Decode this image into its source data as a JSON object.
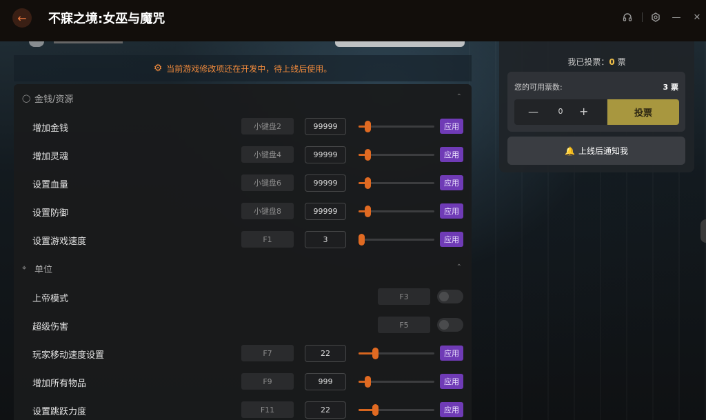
{
  "window": {
    "title": "不寐之境:女巫与魔咒"
  },
  "notice": "当前游戏修改项还在开发中，待上线后使用。",
  "sections": [
    {
      "title": "金钱/资源",
      "rows": [
        {
          "label": "增加金钱",
          "hotkey": "小键盘2",
          "value": "99999",
          "slider": 0.1,
          "apply": "应用"
        },
        {
          "label": "增加灵魂",
          "hotkey": "小键盘4",
          "value": "99999",
          "slider": 0.1,
          "apply": "应用"
        },
        {
          "label": "设置血量",
          "hotkey": "小键盘6",
          "value": "99999",
          "slider": 0.1,
          "apply": "应用"
        },
        {
          "label": "设置防御",
          "hotkey": "小键盘8",
          "value": "99999",
          "slider": 0.1,
          "apply": "应用"
        },
        {
          "label": "设置游戏速度",
          "hotkey": "F1",
          "value": "3",
          "slider": 0.0,
          "apply": "应用"
        }
      ]
    },
    {
      "title": "单位",
      "toggles": [
        {
          "label": "上帝模式",
          "hotkey": "F3",
          "on": false
        },
        {
          "label": "超级伤害",
          "hotkey": "F5",
          "on": false
        }
      ],
      "rows": [
        {
          "label": "玩家移动速度设置",
          "hotkey": "F7",
          "value": "22",
          "slider": 0.2,
          "apply": "应用"
        },
        {
          "label": "增加所有物品",
          "hotkey": "F9",
          "value": "999",
          "slider": 0.1,
          "apply": "应用"
        },
        {
          "label": "设置跳跃力度",
          "hotkey": "F11",
          "value": "22",
          "slider": 0.2,
          "apply": "应用"
        }
      ]
    }
  ],
  "vote": {
    "my_votes_prefix": "我已投票：",
    "my_votes": "0",
    "my_votes_unit": " 票",
    "available_label": "您的可用票数:",
    "available_count": "3 票",
    "stepper_value": "0",
    "vote_button": "投票",
    "notify_button": "上线后通知我"
  },
  "colors": {
    "accent_orange": "#e06a22",
    "apply_purple": "#6f3bb6",
    "vote_gold": "#a8973f",
    "votes_number": "#f2c14a"
  },
  "icons": {
    "back": "arrow-left-icon",
    "headset": "headset-icon",
    "settings": "gear-icon",
    "minimize": "minimize-icon",
    "close": "close-icon",
    "notice": "warning-icon",
    "money": "coin-icon",
    "unit": "crosshair-icon",
    "collapse": "chevron-up-icon",
    "bell": "bell-icon"
  }
}
